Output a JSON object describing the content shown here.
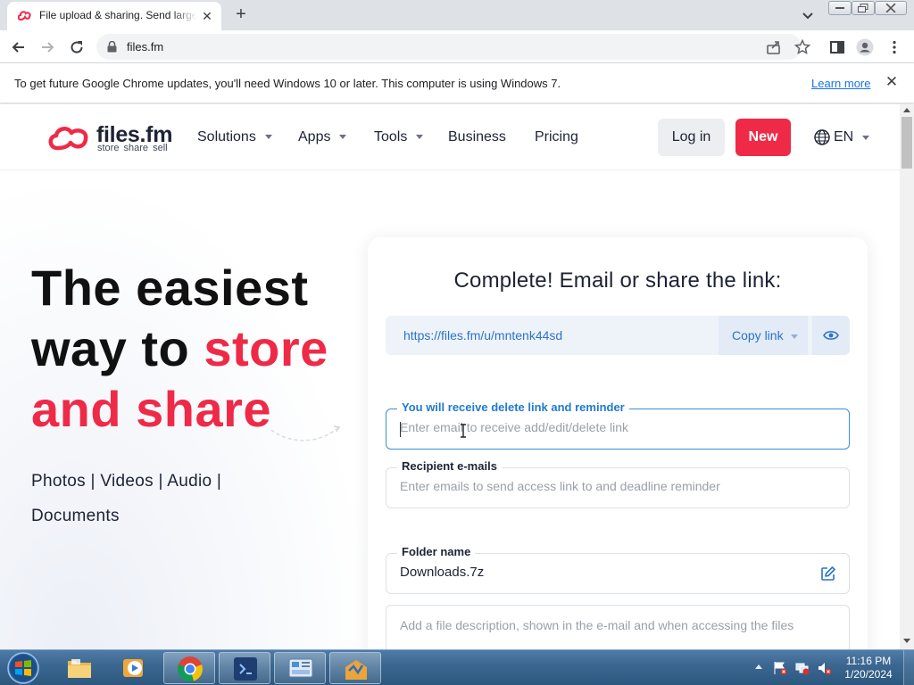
{
  "browser": {
    "tab_title": "File upload & sharing. Send large",
    "url": "files.fm"
  },
  "infobar": {
    "message": "To get future Google Chrome updates, you'll need Windows 10 or later. This computer is using Windows 7.",
    "learn_more": "Learn more"
  },
  "site": {
    "logo_word": "files.fm",
    "logo_tagline": "store share sell",
    "nav": [
      "Solutions",
      "Apps",
      "Tools",
      "Business",
      "Pricing"
    ],
    "login_label": "Log in",
    "new_label": "New",
    "language": "EN"
  },
  "hero": {
    "line1": "The easiest",
    "line2_black": "way to ",
    "line2_accent": "store",
    "line3_accent": "and share",
    "media_links_line1": "Photos | Videos | Audio |",
    "media_links_line2": "Documents"
  },
  "upload_card": {
    "title": "Complete! Email or share the link:",
    "share_url": "https://files.fm/u/mntenk44sd",
    "copy_link_label": "Copy link",
    "delete_field": {
      "label": "You will receive delete link and reminder",
      "placeholder": "Enter email to receive add/edit/delete link",
      "value": ""
    },
    "recipient_field": {
      "label": "Recipient e-mails",
      "placeholder": "Enter emails to send access link to and deadline reminder",
      "value": ""
    },
    "folder_field": {
      "label": "Folder name",
      "value": "Downloads.7z"
    },
    "description_placeholder": "Add a file description, shown in the e-mail and when accessing the files"
  },
  "taskbar": {
    "time": "11:16 PM",
    "date": "1/20/2024"
  },
  "colors": {
    "brand_red": "#ee2a47",
    "link_blue": "#2b72c8",
    "focus_blue": "#3a8fd8"
  },
  "icons": [
    "files-fm-favicon",
    "back-icon",
    "forward-icon",
    "reload-icon",
    "lock-icon",
    "share-icon",
    "star-icon",
    "sidebar-icon",
    "profile-icon",
    "kebab-menu-icon",
    "globe-icon",
    "eye-icon",
    "edit-icon",
    "windows-start-icon",
    "folder-icon",
    "media-player-icon",
    "chrome-icon",
    "vscode-icon",
    "control-panel-icon",
    "app-icon"
  ]
}
